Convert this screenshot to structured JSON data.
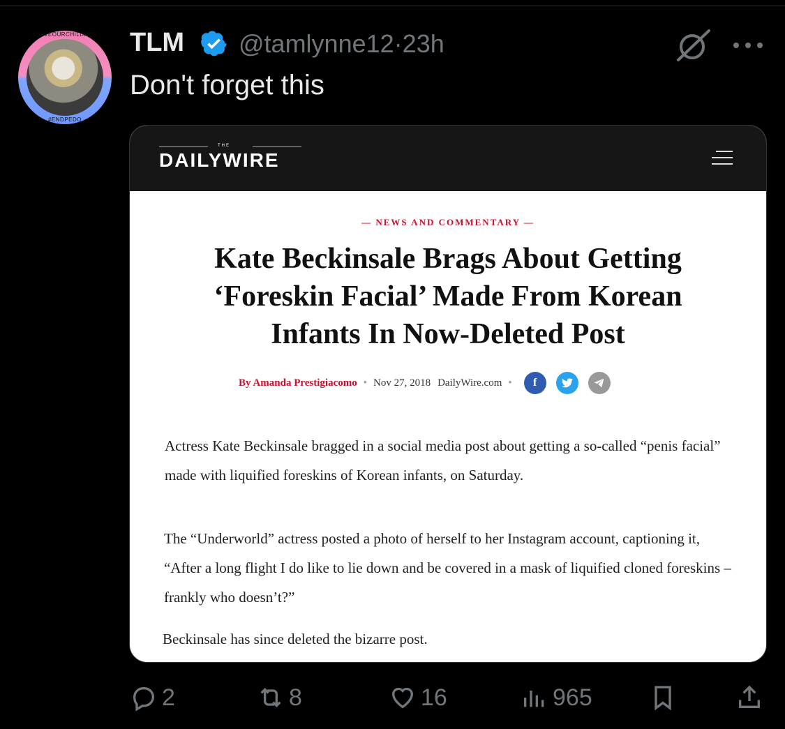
{
  "avatar": {
    "ring_top": "#SAVEOURCHILDREN",
    "ring_bottom": "#ENDPEDO"
  },
  "tweet": {
    "name": "TLM",
    "handle": "@tamlynne12",
    "separator": "·",
    "time": "23h",
    "text": "Don't forget this"
  },
  "card": {
    "logo_small": "THE",
    "logo_main": "DAILYWIRE",
    "kicker": "— NEWS AND COMMENTARY —",
    "headline_lines": [
      "Kate Beckinsale Brags About Getting",
      "‘Foreskin Facial’ Made From Korean",
      "Infants In Now-Deleted Post"
    ],
    "byline": {
      "author": "By  Amanda Prestigiacomo",
      "date": "Nov 27, 2018",
      "site": "DailyWire.com"
    },
    "paragraphs": [
      "Actress Kate Beckinsale bragged in a social media post about getting a so-called “penis facial” made with liquified foreskins of Korean infants, on Saturday.",
      "The “Underworld” actress posted a photo of herself to her Instagram account, captioning it, “After a long flight I do like to lie down and be covered in a mask of liquified cloned foreskins – frankly who doesn’t?”",
      "Beckinsale has since deleted the bizarre post."
    ]
  },
  "actions": {
    "replies": "2",
    "reposts": "8",
    "likes": "16",
    "views": "965"
  },
  "colors": {
    "verified": "#1d9bf0",
    "muted": "#71767b",
    "accent_red": "#c8102e"
  },
  "icons": [
    "verified-badge-icon",
    "grok-icon",
    "more-icon",
    "menu-icon",
    "facebook-icon",
    "twitter-icon",
    "telegram-icon",
    "reply-icon",
    "repost-icon",
    "like-icon",
    "views-icon",
    "bookmark-icon",
    "share-icon"
  ]
}
